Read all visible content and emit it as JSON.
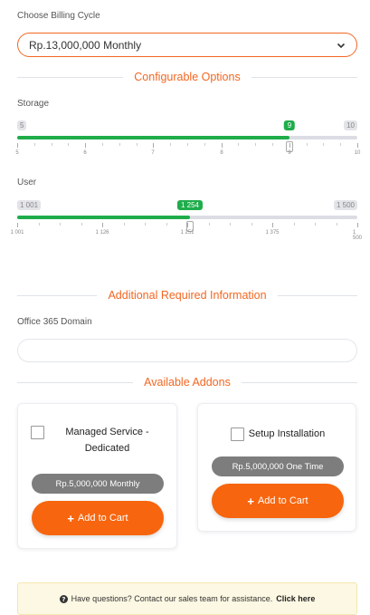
{
  "billing": {
    "label": "Choose Billing Cycle",
    "selected": "Rp.13,000,000 Monthly"
  },
  "configurable": {
    "title": "Configurable Options",
    "storage": {
      "label": "Storage",
      "min": 5,
      "max": 10,
      "value": 9,
      "min_label": "5",
      "max_label": "10",
      "value_label": "9",
      "ticks": [
        "5",
        "6",
        "7",
        "8",
        "9",
        "10"
      ]
    },
    "user": {
      "label": "User",
      "min": 1001,
      "max": 1500,
      "value": 1254,
      "min_label": "1 001",
      "max_label": "1 500",
      "value_label": "1 254",
      "ticks": [
        "1 001",
        "1 126",
        "1 251",
        "1 375",
        "1 500"
      ]
    }
  },
  "additional": {
    "title": "Additional Required Information",
    "domain_label": "Office 365 Domain",
    "domain_value": ""
  },
  "addons": {
    "title": "Available Addons",
    "items": [
      {
        "name": "Managed Service - Dedicated",
        "price": "Rp.5,000,000 Monthly",
        "button": "Add to Cart",
        "checked": false
      },
      {
        "name": "Setup Installation",
        "price": "Rp.5,000,000 One Time",
        "button": "Add to Cart",
        "checked": false
      }
    ]
  },
  "notice": {
    "text": "Have questions? Contact our sales team for assistance.",
    "link": "Click here"
  },
  "colors": {
    "accent": "#f26722",
    "button": "#f7650e",
    "slider_fill": "#1fad4b",
    "price_pill": "#7d7d7d"
  }
}
